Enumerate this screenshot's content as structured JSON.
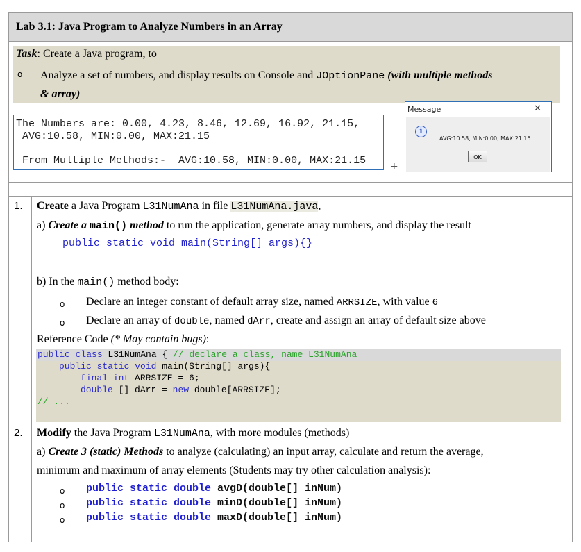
{
  "lab_title": "Lab 3.1: Java Program to Analyze Numbers in an Array",
  "task": {
    "label": "Task",
    "text": ": Create a Java program, to",
    "bullet_pre": "Analyze a set of numbers, and display results on Console and ",
    "bullet_code": "JOptionPane",
    "bullet_emph1": " (with multiple methods",
    "bullet_emph2": "& array)"
  },
  "console": {
    "line1": "The Numbers are: 0.00, 4.23, 8.46, 12.69, 16.92, 21.15,",
    "line2": " AVG:10.58, MIN:0.00, MAX:21.15",
    "line3": " From Multiple Methods:-  AVG:10.58, MIN:0.00, MAX:21.15",
    "plus": "+"
  },
  "dialog": {
    "title": "Message",
    "close": "✕",
    "icon": "i",
    "message": "AVG:10.58, MIN:0.00, MAX:21.15",
    "ok": "OK"
  },
  "step1": {
    "num": "1.",
    "create": "Create",
    "line1_mid": " a Java Program ",
    "class_name": "L31NumAna",
    "line1_mid2": "  in file ",
    "file_name": "L31NumAna.java",
    "line1_end": ",",
    "a_pre": "a) ",
    "a_emph1": "Create a ",
    "a_code": "main()",
    "a_emph2": " method",
    "a_rest": " to run the application, generate array numbers, and display the result",
    "main_sig": "public static void main(String[] args){}",
    "b_pre": "b) In the ",
    "b_code": "main()",
    "b_rest": " method body:",
    "b1_pre": "Declare an integer constant of default array size, named ",
    "b1_code": "ARRSIZE",
    "b1_mid": ", with value ",
    "b1_val": "6",
    "b2_pre": "Declare an array of ",
    "b2_code1": "double",
    "b2_mid": ", named ",
    "b2_code2": "dArr",
    "b2_rest": ", create and assign an array of default size above",
    "ref_pre": "Reference Code ",
    "ref_emph": "(* May contain bugs)",
    "ref_end": ":",
    "code": {
      "l1_kw": "public class",
      "l1_name": " L31NumAna { ",
      "l1_cm": "// declare a class, name L31NumAna",
      "l2_kw": "public static void",
      "l2_rest": " main(String[] args){",
      "l3_kw": "final int",
      "l3_rest": " ARRSIZE = 6;",
      "l4_kw": "double",
      "l4_mid": " [] dArr = ",
      "l4_kw2": "new",
      "l4_rest": " double[ARRSIZE];",
      "l5_cm": "// ..."
    }
  },
  "step2": {
    "num": "2.",
    "modify": "Modify",
    "line1_mid": " the Java Program ",
    "class_name": "L31NumAna",
    "line1_rest": ", with more modules (methods)",
    "a_pre": "a) ",
    "a_emph": "Create 3 (static) Methods",
    "a_rest": " to analyze (calculating) an input array, calculate and return the average,",
    "a_line2": "minimum and maximum of array elements (Students may try other calculation analysis):",
    "methods": [
      {
        "kw": "public static double",
        "sig": " avgD(double[] inNum)"
      },
      {
        "kw": "public static double",
        "sig": " minD(double[] inNum)"
      },
      {
        "kw": "public static double",
        "sig": " maxD(double[] inNum)"
      }
    ]
  },
  "bullet_glyph": "o"
}
